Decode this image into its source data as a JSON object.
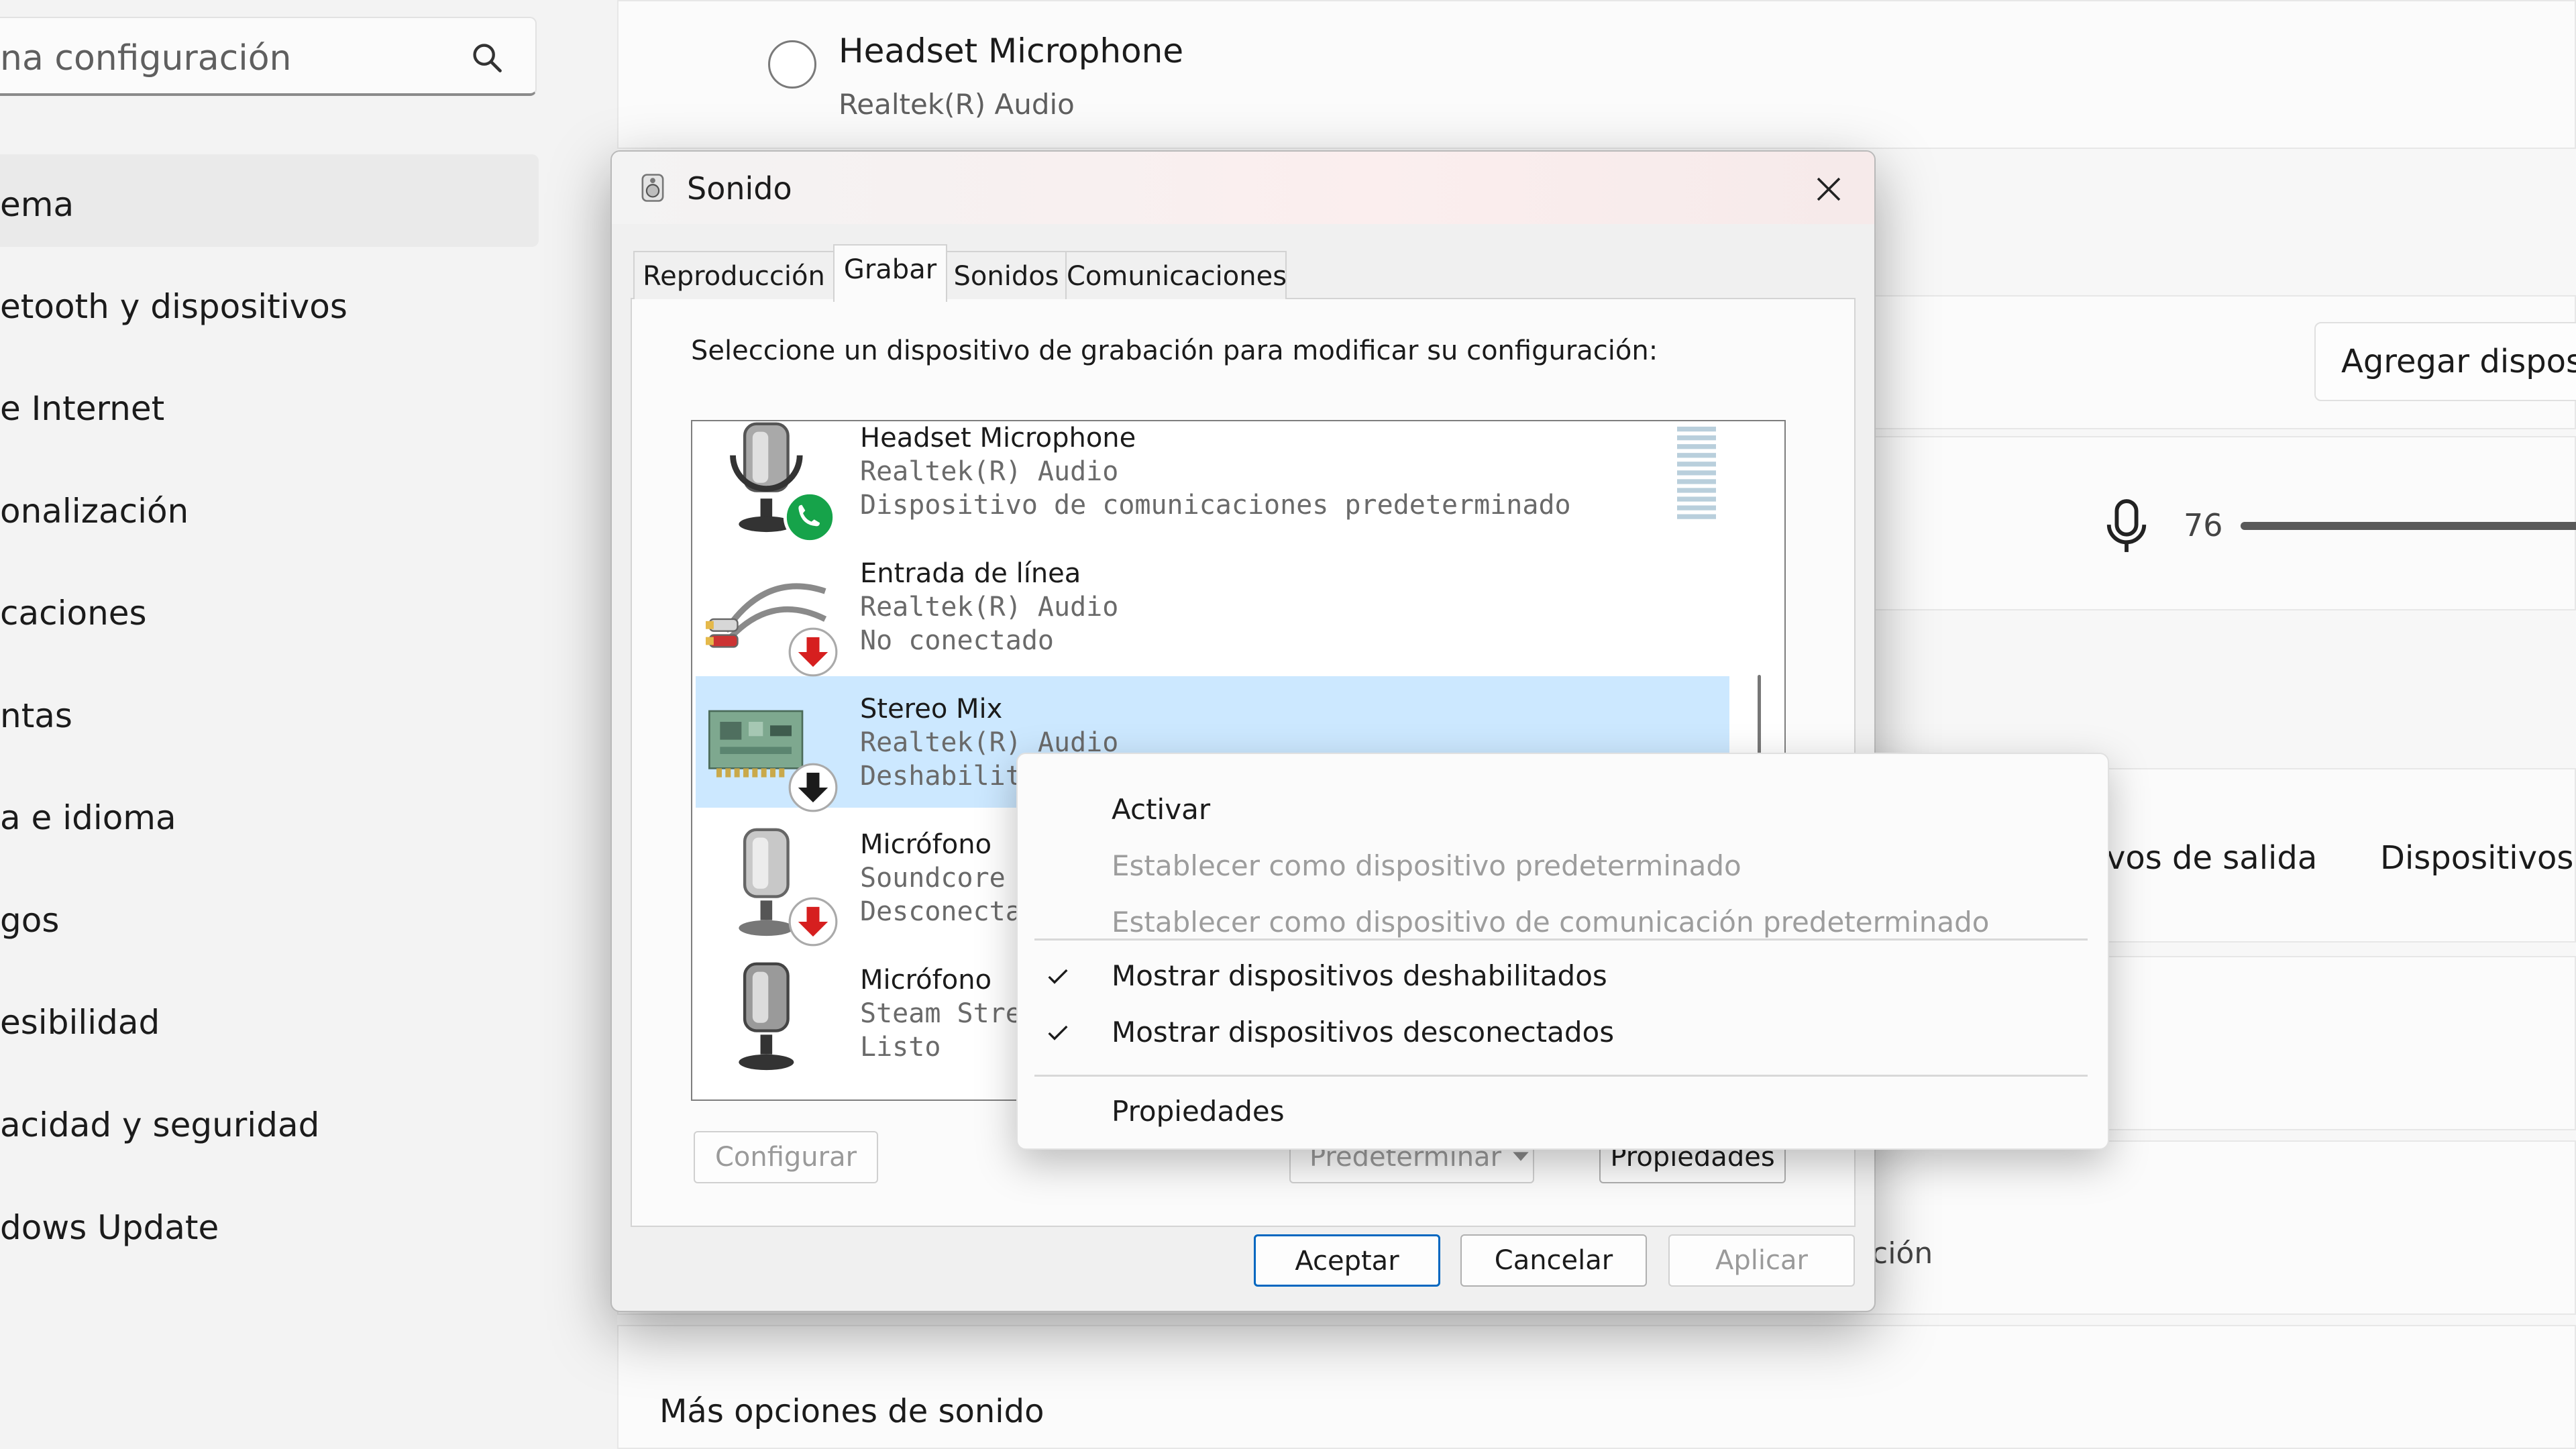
{
  "settings": {
    "search_text": "na configuración",
    "nav": [
      "ema",
      "etooth y dispositivos",
      "e Internet",
      "onalización",
      "caciones",
      "ntas",
      "a e idioma",
      "gos",
      "esibilidad",
      "acidad y seguridad",
      "dows Update"
    ],
    "input_device_name": "Headset Microphone",
    "input_device_sub": "Realtek(R) Audio",
    "add_device_label": "Agregar dispos",
    "volume_value": "76",
    "output_tab_fragment": "vos de salida",
    "devices_tab_fragment": "Dispositivos",
    "fragment_cion": "ción",
    "more_sound_options": "Más opciones de sonido"
  },
  "dialog": {
    "title": "Sonido",
    "tabs": [
      "Reproducción",
      "Grabar",
      "Sonidos",
      "Comunicaciones"
    ],
    "active_tab": "Grabar",
    "instruction": "Seleccione un dispositivo de grabación para modificar su configuración:",
    "devices": [
      {
        "name": "Headset Microphone",
        "driver": "Realtek(R) Audio",
        "status": "Dispositivo de comunicaciones predeterminado",
        "icon": "headset-mic-icon",
        "badge": "phone-badge-icon"
      },
      {
        "name": "Entrada de línea",
        "driver": "Realtek(R) Audio",
        "status": "No conectado",
        "icon": "line-in-cable-icon",
        "badge": "down-arrow-red-badge-icon"
      },
      {
        "name": "Stereo Mix",
        "driver": "Realtek(R) Audio",
        "status": "Deshabilitado",
        "icon": "sound-card-icon",
        "badge": "down-arrow-black-badge-icon"
      },
      {
        "name": "Micrófono",
        "driver": "Soundcore",
        "status": "Desconectado",
        "icon": "microphone-icon",
        "badge": "down-arrow-red-badge-icon"
      },
      {
        "name": "Micrófono",
        "driver": "Steam Streaming",
        "status": "Listo",
        "icon": "microphone-icon",
        "badge": ""
      }
    ],
    "buttons": {
      "configure": "Configurar",
      "set_default": "Predeterminar",
      "properties": "Propiedades",
      "ok": "Aceptar",
      "cancel": "Cancelar",
      "apply": "Aplicar"
    }
  },
  "context_menu": {
    "items": [
      {
        "label": "Activar",
        "enabled": true,
        "checked": false
      },
      {
        "label": "Establecer como dispositivo predeterminado",
        "enabled": false,
        "checked": false
      },
      {
        "label": "Establecer como dispositivo de comunicación predeterminado",
        "enabled": false,
        "checked": false
      },
      {
        "label": "Mostrar dispositivos deshabilitados",
        "enabled": true,
        "checked": true
      },
      {
        "label": "Mostrar dispositivos desconectados",
        "enabled": true,
        "checked": true
      },
      {
        "label": "Propiedades",
        "enabled": true,
        "checked": false
      }
    ]
  },
  "colors": {
    "selection": "#cce8ff",
    "accent": "#0067c0",
    "badge_green": "#16a34a",
    "badge_red": "#d61f1f"
  }
}
